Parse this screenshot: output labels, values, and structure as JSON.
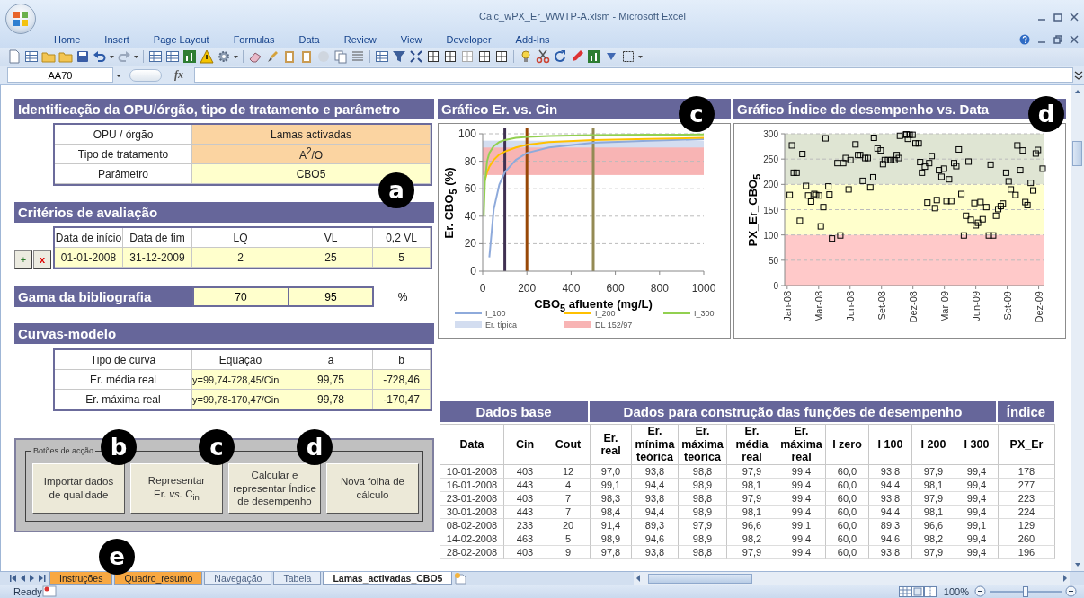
{
  "window": {
    "title": "Calc_wPX_Er_WWTP-A.xlsm - Microsoft Excel"
  },
  "ribbon_tabs": [
    "Home",
    "Insert",
    "Page Layout",
    "Formulas",
    "Data",
    "Review",
    "View",
    "Developer",
    "Add-Ins"
  ],
  "formula_bar": {
    "name_box": "AA70",
    "function_label": "fx"
  },
  "identification": {
    "title": "Identificação da OPU/órgão, tipo de tratamento e parâmetro",
    "callout": "a",
    "rows": [
      {
        "label": "OPU / órgão",
        "value": "Lamas activadas",
        "kind": "selection"
      },
      {
        "label": "Tipo de tratamento",
        "value": "A$^{2}$/O",
        "kind": "selection"
      },
      {
        "label": "Parâmetro",
        "value": "CBO5",
        "kind": "entry"
      }
    ]
  },
  "criteria": {
    "title": "Critérios de avaliação",
    "add_button": "+",
    "remove_button": "x",
    "columns": [
      "Data de início",
      "Data de fim",
      "LQ",
      "VL",
      "0,2 VL"
    ],
    "values": [
      "01-01-2008",
      "31-12-2009",
      "2",
      "25",
      "5"
    ]
  },
  "bibliography": {
    "title": "Gama da bibliografia",
    "min": "70",
    "max": "95",
    "unit": "%"
  },
  "model_curves": {
    "title": "Curvas-modelo",
    "columns": [
      "Tipo de curva",
      "Equação",
      "a",
      "b"
    ],
    "rows": [
      [
        "Er. média real",
        "y=99,74-728,45/Cin",
        "99,75",
        "-728,46"
      ],
      [
        "Er. máxima real",
        "y=99,78-170,47/Cin",
        "99,78",
        "-170,47"
      ]
    ]
  },
  "action_buttons": {
    "group_label": "Botões de acção",
    "buttons": [
      {
        "label": "Importar dados\nde qualidade",
        "callout": "b"
      },
      {
        "label": "Representar\nEr. *vs.* C$_{in}$",
        "callout": "c"
      },
      {
        "label": "Calcular e\nrepresentar Índice\nde desempenho",
        "callout": "d"
      },
      {
        "label": "Nova folha de\ncálculo"
      }
    ]
  },
  "charts": [
    {
      "callout": "c",
      "chart_data": {
        "type": "line",
        "title": "Gráfico Er. vs. Cin",
        "xlabel": "CBO$_{5}$ afluente (mg/L)",
        "ylabel": "Er. CBO$_{5}$ (%)",
        "x": [
          5,
          10,
          20,
          30,
          50,
          75,
          100,
          150,
          200,
          300,
          500,
          750,
          1000
        ],
        "xlim": [
          0,
          1000
        ],
        "ylim": [
          0,
          100
        ],
        "xticks": [
          0,
          200,
          400,
          600,
          800,
          1000
        ],
        "yticks": [
          0,
          20,
          40,
          60,
          80,
          100
        ],
        "series": [
          {
            "name": "I_100",
            "color": "#8eaadb",
            "values": [
              null,
              null,
              null,
              10,
              45,
              63,
              72,
              81,
              86,
              90,
              93.5,
              95,
              96
            ]
          },
          {
            "name": "I_200",
            "color": "#ffc000",
            "values": [
              null,
              66,
              72,
              76,
              81,
              85,
              87,
              90,
              92,
              94,
              95.5,
              96.3,
              97
            ]
          },
          {
            "name": "I_300",
            "color": "#92d050",
            "values": [
              40,
              65,
              80,
              86,
              91,
              94,
              95.5,
              97,
              97.7,
              98.4,
              99,
              99.3,
              99.5
            ]
          }
        ],
        "grid": true,
        "legend": true,
        "bands": [
          {
            "axis": "y",
            "from": 85,
            "to": 95,
            "color": "#d3ddf0",
            "label": "Er. típica"
          },
          {
            "axis": "y",
            "from": 70,
            "to": 90,
            "color": "#f8b4b4",
            "label": "DL 152/97"
          }
        ],
        "ref_lines": [
          {
            "axis": "x",
            "value": 100,
            "color": "#403152"
          },
          {
            "axis": "x",
            "value": 200,
            "color": "#984807"
          },
          {
            "axis": "x",
            "value": 500,
            "color": "#948a54"
          }
        ]
      }
    },
    {
      "callout": "d",
      "chart_data": {
        "type": "scatter",
        "title": "Gráfico Índice de desempenho vs. Data",
        "ylabel": "PX_Er_CBO$_{5}$",
        "xlim": [
          "2007-12-25",
          "2009-12-13"
        ],
        "ylim": [
          0,
          300
        ],
        "yticks": [
          0,
          50,
          100,
          150,
          200,
          250,
          300
        ],
        "xticks": [
          {
            "value": "2008-01-01",
            "label": "Jan-08"
          },
          {
            "value": "2008-03-28",
            "label": "Mar-08"
          },
          {
            "value": "2008-06-23",
            "label": "Jun-08"
          },
          {
            "value": "2008-09-18",
            "label": "Set-08"
          },
          {
            "value": "2008-12-14",
            "label": "Dez-08"
          },
          {
            "value": "2009-03-11",
            "label": "Mar-09"
          },
          {
            "value": "2009-06-06",
            "label": "Jun-09"
          },
          {
            "value": "2009-09-01",
            "label": "Set-09"
          },
          {
            "value": "2009-11-27",
            "label": "Dez-09"
          }
        ],
        "x": [
          "2008-01-08",
          "2008-01-14",
          "2008-01-19",
          "2008-01-27",
          "2008-02-05",
          "2008-02-12",
          "2008-02-22",
          "2008-02-28",
          "2008-03-07",
          "2008-03-16",
          "2008-03-21",
          "2008-03-29",
          "2008-04-03",
          "2008-04-10",
          "2008-04-16",
          "2008-04-24",
          "2008-04-27",
          "2008-05-04",
          "2008-05-19",
          "2008-05-27",
          "2008-06-04",
          "2008-06-11",
          "2008-06-19",
          "2008-06-24",
          "2008-07-08",
          "2008-07-15",
          "2008-07-21",
          "2008-07-28",
          "2008-08-04",
          "2008-08-11",
          "2008-08-18",
          "2008-08-26",
          "2008-08-28",
          "2008-09-07",
          "2008-09-16",
          "2008-09-22",
          "2008-09-27",
          "2008-10-06",
          "2008-10-15",
          "2008-10-24",
          "2008-10-30",
          "2008-11-05",
          "2008-11-08",
          "2008-11-21",
          "2008-11-26",
          "2008-11-30",
          "2008-12-05",
          "2008-12-13",
          "2008-12-21",
          "2008-12-30",
          "2009-01-03",
          "2009-01-08",
          "2009-01-16",
          "2009-01-23",
          "2009-01-28",
          "2009-02-04",
          "2009-02-13",
          "2009-02-18",
          "2009-02-24",
          "2009-03-03",
          "2009-03-10",
          "2009-03-17",
          "2009-03-24",
          "2009-03-30",
          "2009-04-07",
          "2009-04-13",
          "2009-04-20",
          "2009-04-27",
          "2009-05-04",
          "2009-05-10",
          "2009-05-17",
          "2009-05-23",
          "2009-06-02",
          "2009-06-06",
          "2009-06-12",
          "2009-06-19",
          "2009-06-25",
          "2009-07-05",
          "2009-07-12",
          "2009-07-17",
          "2009-07-24",
          "2009-08-01",
          "2009-08-07",
          "2009-08-14",
          "2009-08-20",
          "2009-08-29",
          "2009-09-05",
          "2009-09-11",
          "2009-09-24",
          "2009-09-29",
          "2009-10-07",
          "2009-10-14",
          "2009-10-21",
          "2009-10-27",
          "2009-11-05",
          "2009-11-12",
          "2009-11-19",
          "2009-11-25",
          "2009-12-08"
        ],
        "series": [
          {
            "color": "#000000",
            "values": [
              179,
              277,
              223,
              223,
              128,
              260,
              197,
              178,
              166,
              181,
              179,
              178,
              117,
              155,
              291,
              196,
              180,
              93,
              242,
              99,
              242,
              252,
              190,
              248,
              279,
              258,
              258,
              207,
              252,
              252,
              194,
              214,
              292,
              271,
              267,
              240,
              248,
              248,
              248,
              248,
              258,
              252,
              296,
              298,
              299,
              290,
              298,
              298,
              281,
              281,
              244,
              223,
              235,
              164,
              242,
              256,
              153,
              169,
              228,
              215,
              231,
              167,
              210,
              167,
              242,
              236,
              269,
              181,
              99,
              138,
              245,
              130,
              163,
              119,
              124,
              165,
              131,
              155,
              99,
              239,
              99,
              138,
              151,
              157,
              162,
              223,
              206,
              190,
              179,
              277,
              228,
              267,
              165,
              159,
              203,
              188,
              261,
              268,
              231
            ]
          }
        ],
        "grid": true,
        "bands": [
          {
            "axis": "y",
            "from": 200,
            "to": 300,
            "color": "#dfe5d3"
          },
          {
            "axis": "y",
            "from": 100,
            "to": 200,
            "color": "#ffffcc"
          },
          {
            "axis": "y",
            "from": 0,
            "to": 100,
            "color": "#ffc9c9"
          }
        ]
      }
    }
  ],
  "data_table": {
    "groups": [
      {
        "label": "Dados base",
        "columns": [
          "Data",
          "Cin",
          "Cout"
        ]
      },
      {
        "label": "Dados para construção das funções de desempenho",
        "columns": [
          "Er.\nreal",
          "Er.\nmínima\nteórica",
          "Er.\nmáxima\nteórica",
          "Er.\nmédia\nreal",
          "Er.\nmáxima\nreal",
          "I zero",
          "I 100",
          "I 200",
          "I 300"
        ]
      },
      {
        "label": "Índice",
        "columns": [
          "PX_Er"
        ]
      }
    ],
    "rows": [
      [
        "10-01-2008",
        "403",
        "12",
        "97,0",
        "93,8",
        "98,8",
        "97,9",
        "99,4",
        "60,0",
        "93,8",
        "97,9",
        "99,4",
        "178"
      ],
      [
        "16-01-2008",
        "443",
        "4",
        "99,1",
        "94,4",
        "98,9",
        "98,1",
        "99,4",
        "60,0",
        "94,4",
        "98,1",
        "99,4",
        "277"
      ],
      [
        "23-01-2008",
        "403",
        "7",
        "98,3",
        "93,8",
        "98,8",
        "97,9",
        "99,4",
        "60,0",
        "93,8",
        "97,9",
        "99,4",
        "223"
      ],
      [
        "30-01-2008",
        "443",
        "7",
        "98,4",
        "94,4",
        "98,9",
        "98,1",
        "99,4",
        "60,0",
        "94,4",
        "98,1",
        "99,4",
        "224"
      ],
      [
        "08-02-2008",
        "233",
        "20",
        "91,4",
        "89,3",
        "97,9",
        "96,6",
        "99,1",
        "60,0",
        "89,3",
        "96,6",
        "99,1",
        "129"
      ],
      [
        "14-02-2008",
        "463",
        "5",
        "98,9",
        "94,6",
        "98,9",
        "98,2",
        "99,4",
        "60,0",
        "94,6",
        "98,2",
        "99,4",
        "260"
      ],
      [
        "28-02-2008",
        "403",
        "9",
        "97,8",
        "93,8",
        "98,8",
        "97,9",
        "99,4",
        "60,0",
        "93,8",
        "97,9",
        "99,4",
        "196"
      ]
    ]
  },
  "sheet_tabs": {
    "callout": "e",
    "tabs": [
      {
        "label": "Instruções",
        "selected": false,
        "color": "#f8a842"
      },
      {
        "label": "Quadro_resumo",
        "selected": false,
        "color": "#f8a842"
      },
      {
        "label": "Navegação",
        "selected": false
      },
      {
        "label": "Tabela",
        "selected": false
      },
      {
        "label": "Lamas_activadas_CBO5",
        "selected": true
      }
    ]
  },
  "status_bar": {
    "status": "Ready",
    "zoom": "100%",
    "zoom_slider": {
      "level": 0.5
    }
  }
}
